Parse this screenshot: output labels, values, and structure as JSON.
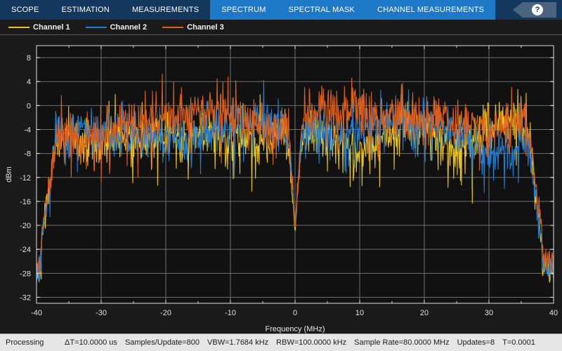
{
  "toolbar": {
    "tabs": [
      {
        "label": "SCOPE",
        "active": false
      },
      {
        "label": "ESTIMATION",
        "active": false
      },
      {
        "label": "MEASUREMENTS",
        "active": false
      },
      {
        "label": "SPECTRUM",
        "active": true
      },
      {
        "label": "SPECTRAL MASK",
        "active": true
      },
      {
        "label": "CHANNEL MEASUREMENTS",
        "active": true
      }
    ],
    "help_glyph": "?"
  },
  "legend": {
    "items": [
      {
        "label": "Channel 1",
        "color": "#e8c31e"
      },
      {
        "label": "Channel 2",
        "color": "#1e7fd4"
      },
      {
        "label": "Channel 3",
        "color": "#dd5f1c"
      }
    ]
  },
  "statusbar": {
    "processing": "Processing",
    "fields": [
      "ΔT=10.0000 us",
      "Samples/Update=800",
      "VBW=1.7684 kHz",
      "RBW=100.0000 kHz",
      "Sample Rate=80.0000 MHz",
      "Updates=8",
      "T=0.0001"
    ]
  },
  "colors": {
    "background": "#1a1a1a",
    "plot_background": "#111111",
    "grid": "#6e6e6e",
    "axis": "#e0e0e0",
    "tab_bar": "#14375e",
    "tab_active": "#1e78c8",
    "status_bg": "#e6e6e6"
  },
  "chart_data": {
    "type": "line",
    "title": "",
    "xlabel": "Frequency (MHz)",
    "ylabel": "dBm",
    "xlim": [
      -40,
      40
    ],
    "ylim": [
      -33,
      10
    ],
    "xticks": [
      -40,
      -30,
      -20,
      -10,
      0,
      10,
      20,
      30,
      40
    ],
    "xticklabels": [
      "-40",
      "-30",
      "-20",
      "-10",
      "0",
      "10",
      "20",
      "30",
      "40"
    ],
    "yticks": [
      8,
      4,
      0,
      -4,
      -8,
      -12,
      -16,
      -20,
      -24,
      -28,
      -32
    ],
    "yticklabels": [
      "8",
      "4",
      "0",
      "-4",
      "-8",
      "-12",
      "-16",
      "-20",
      "-24",
      "-28",
      "-32"
    ],
    "grid": true,
    "legend_position": "top-left-outside",
    "notes": [
      "Noisy multi-channel spectrum analyzer trace",
      "Flat passband roughly -40 to +38 MHz averaging about -4 dBm",
      "Deep DC notch at 0 MHz reaching about -21 dBm",
      "Sharp roll-off below -39 MHz to about -28 dBm and above 38 MHz to about -27 dBm",
      "Channel 3 (orange) sits highest with peaks to +6 dBm, Channel 1 (yellow) lowest"
    ],
    "series": [
      {
        "name": "Channel 1",
        "color": "#e8c31e",
        "seed": 1337,
        "floor_dbm": -28.5,
        "mean_dbm": -5.6,
        "ripple": 4.6,
        "peak_dbm": 4.2,
        "notch_depth_dbm": -21.5
      },
      {
        "name": "Channel 2",
        "color": "#1e7fd4",
        "seed": 8821,
        "floor_dbm": -28.0,
        "mean_dbm": -4.6,
        "ripple": 4.4,
        "peak_dbm": 4.6,
        "notch_depth_dbm": -20.0
      },
      {
        "name": "Channel 3",
        "color": "#dd5f1c",
        "seed": 4201,
        "floor_dbm": -27.0,
        "mean_dbm": -3.4,
        "ripple": 4.6,
        "peak_dbm": 6.0,
        "notch_depth_dbm": -21.0
      }
    ]
  }
}
